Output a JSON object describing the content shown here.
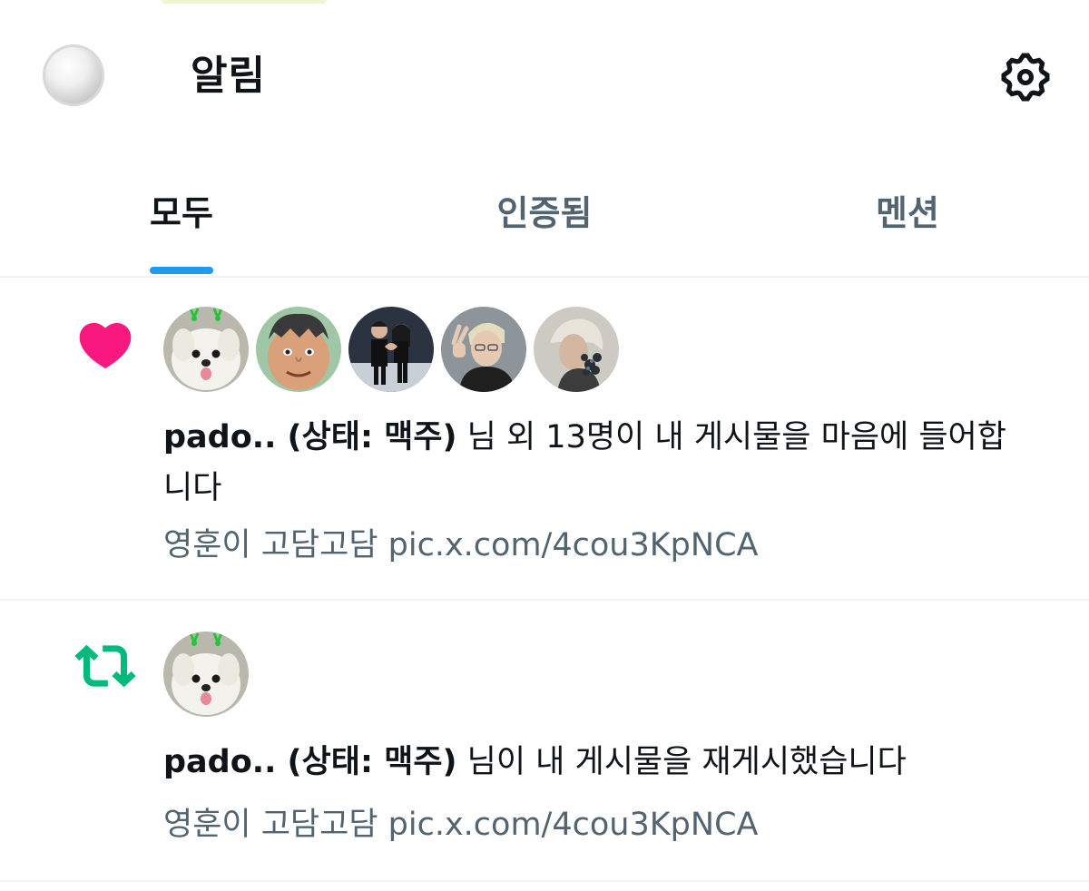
{
  "header": {
    "title": "알림",
    "profile_avatar_icon": "profile-avatar",
    "settings_icon": "gear-icon"
  },
  "tabs": [
    {
      "label": "모두",
      "active": true
    },
    {
      "label": "인증됨",
      "active": false
    },
    {
      "label": "멘션",
      "active": false
    }
  ],
  "notifications": [
    {
      "type": "like",
      "icon": "heart-icon",
      "icon_color": "#f91880",
      "user_name": "pado.. (상태: 맥주)",
      "message": " 님 외 13명이 내 게시물을 마음에 들어합니다",
      "post_text": "영훈이 고담고담 pic.x.com/4cou3KpNCA"
    },
    {
      "type": "repost",
      "icon": "repost-icon",
      "icon_color": "#00ba7c",
      "user_name": "pado.. (상태: 맥주)",
      "message": " 님이 내 게시물을 재게시했습니다",
      "post_text": "영훈이 고담고담 pic.x.com/4cou3KpNCA"
    }
  ],
  "colors": {
    "accent": "#1d9bf0",
    "like": "#f91880",
    "repost": "#00ba7c",
    "secondary_text": "#536471"
  }
}
